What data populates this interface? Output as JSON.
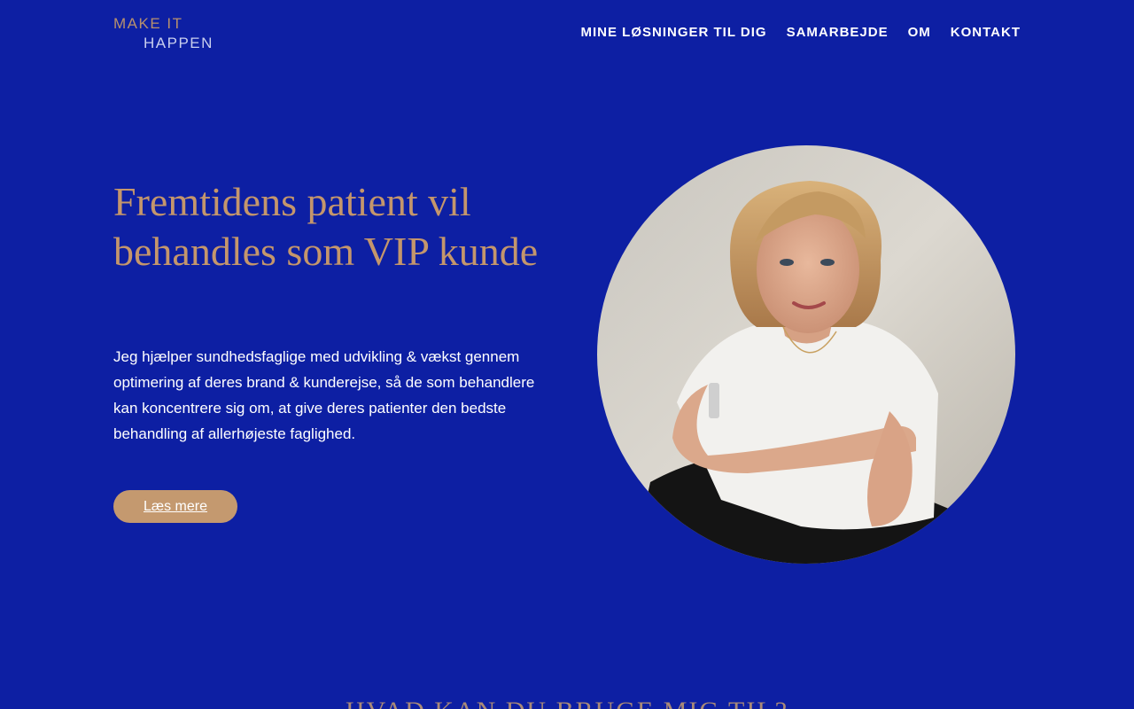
{
  "brand": {
    "logo_line1": "MAKE IT",
    "logo_line2": "HAPPEN"
  },
  "nav": {
    "items": [
      {
        "label": "MINE LØSNINGER TIL DIG"
      },
      {
        "label": "SAMARBEJDE"
      },
      {
        "label": "OM"
      },
      {
        "label": "KONTAKT"
      }
    ]
  },
  "hero": {
    "title": "Fremtidens patient vil behandles som VIP kunde",
    "description": "Jeg hjælper sundhedsfaglige med udvikling & vækst gennem optimering af deres brand & kunderejse, så de som behandlere kan koncentrere sig om, at give deres patienter den bedste behandling af allerhøjeste faglighed.",
    "cta_label": "Læs mere"
  },
  "section2": {
    "heading_partial": "HVAD KAN DU BRUGE MIG TIL?"
  },
  "colors": {
    "background": "#0d1fa3",
    "accent_gold": "#c4966c",
    "text_white": "#ffffff"
  }
}
